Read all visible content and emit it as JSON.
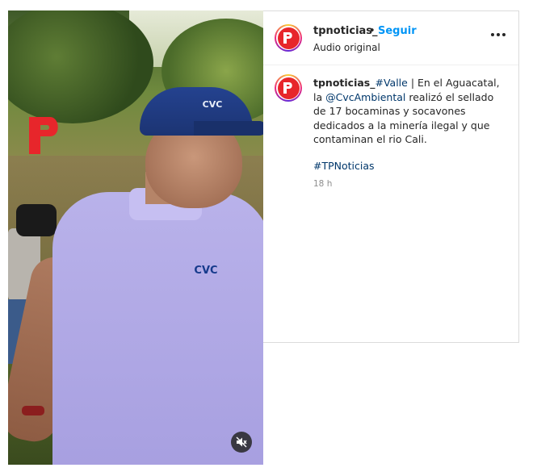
{
  "header": {
    "username": "tpnoticias_",
    "separator": "•",
    "follow_label": "Seguir",
    "audio_label": "Audio original"
  },
  "caption": {
    "username": "tpnoticias_",
    "hashtag_valle": "#Valle",
    "text_part1": " | En el Aguacatal, la ",
    "mention": "@CvcAmbiental",
    "text_part2": " realizó el sellado de 17 bocaminas y socavones dedicados a la minería ilegal y que contaminan el rio Cali.",
    "hashtag_tp": "#TPNoticias",
    "timestamp": "18 h"
  },
  "video": {
    "overlay_logo": "P",
    "cap_logo": "CVC",
    "shirt_logo": "CVC"
  },
  "icons": {
    "mute": "speaker-muted-icon",
    "more": "more-options-icon",
    "avatar": "tp-logo"
  },
  "colors": {
    "brand_red": "#e7262b",
    "follow_blue": "#0095f6",
    "link_blue": "#00376b",
    "meta_gray": "#8e8e8e"
  }
}
